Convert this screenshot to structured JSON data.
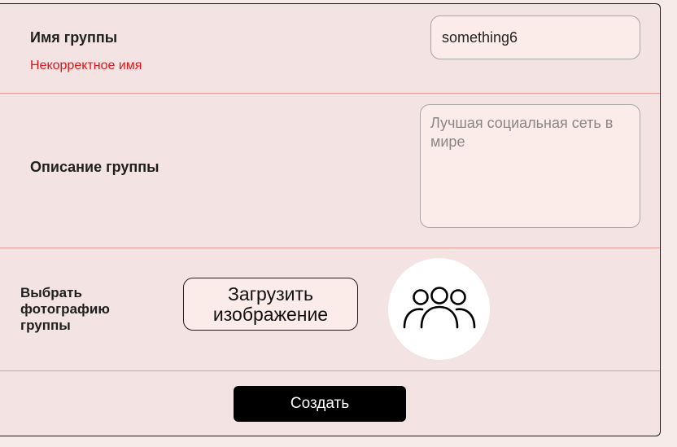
{
  "form": {
    "name": {
      "label": "Имя группы",
      "value": "something6",
      "error": "Некорректное имя"
    },
    "description": {
      "label": "Описание группы",
      "placeholder": "Лучшая социальная сеть в мире",
      "value": ""
    },
    "photo": {
      "label": "Выбрать фотографию группы",
      "upload_label": "Загрузить изображение",
      "avatar_icon": "group-people-icon"
    },
    "submit_label": "Создать"
  },
  "colors": {
    "panel_bg": "#f3e3e2",
    "page_bg": "#f7ebe9",
    "input_bg": "#fbecea",
    "divider": "#e89a94",
    "error": "#e0151b",
    "submit_bg": "#000000",
    "submit_text": "#ffffff"
  }
}
